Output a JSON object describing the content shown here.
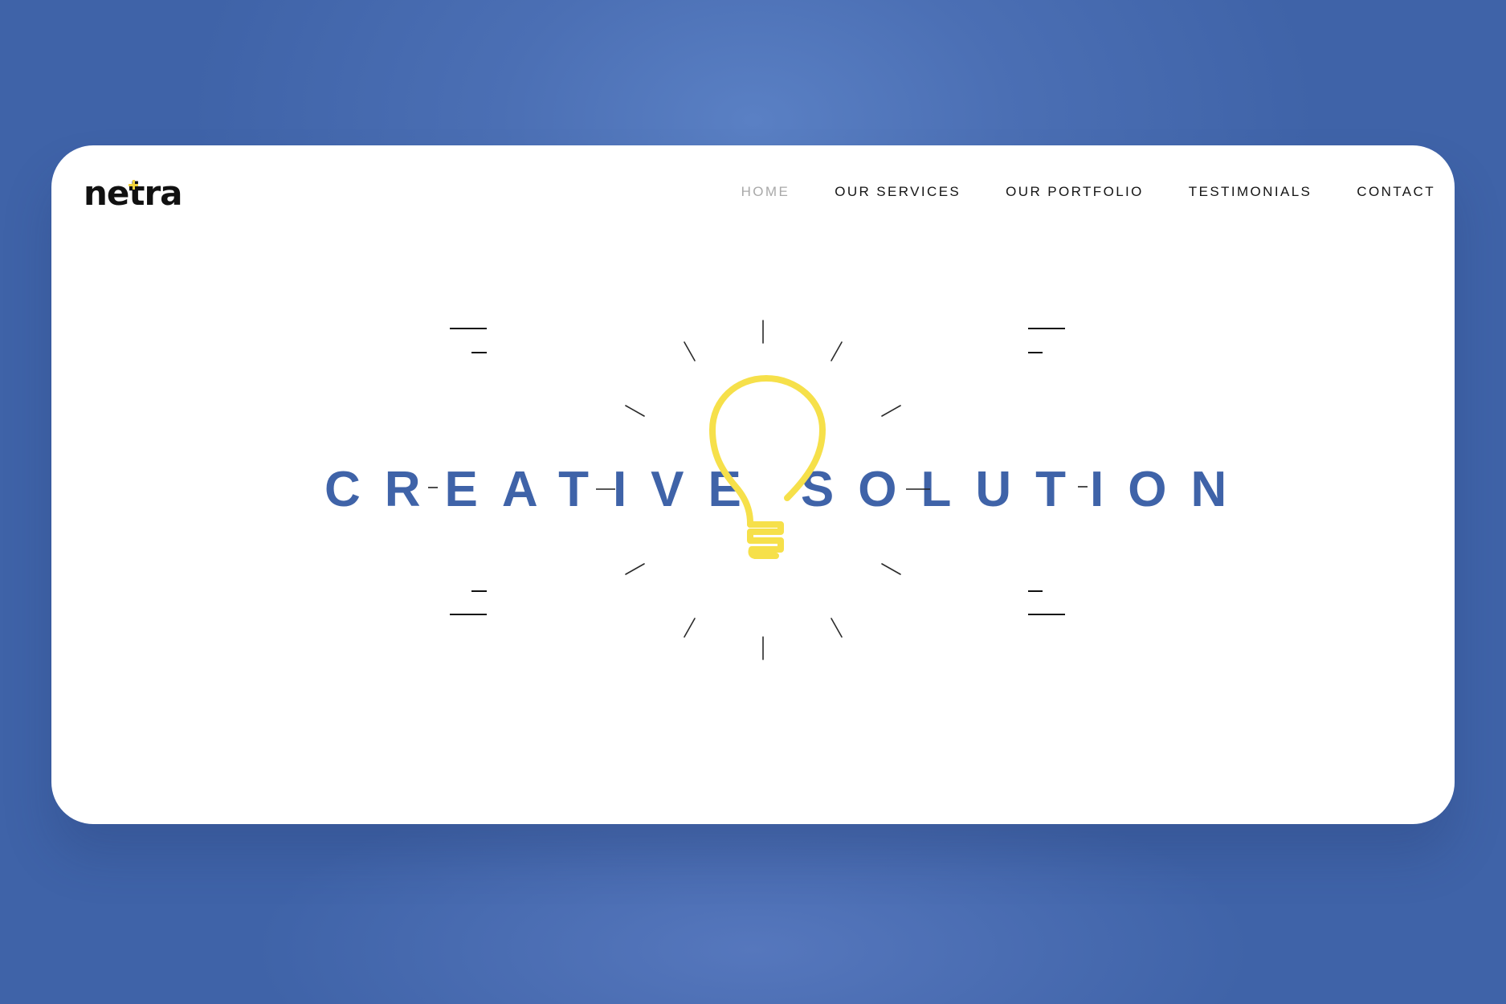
{
  "logo": {
    "text": "netra"
  },
  "nav": {
    "items": [
      {
        "label": "HOME",
        "active": true
      },
      {
        "label": "OUR SERVICES",
        "active": false
      },
      {
        "label": "OUR PORTFOLIO",
        "active": false
      },
      {
        "label": "TESTIMONIALS",
        "active": false
      },
      {
        "label": "CONTACT",
        "active": false
      }
    ]
  },
  "hero": {
    "headline_left": "CREATIVE",
    "headline_right": "SOLUTION",
    "icon": "lightbulb-icon"
  },
  "colors": {
    "background": "#4b6fb4",
    "headline": "#3f63a8",
    "bulb": "#f6e04a",
    "nav_active": "#a9a9a9",
    "nav_text": "#141414"
  }
}
